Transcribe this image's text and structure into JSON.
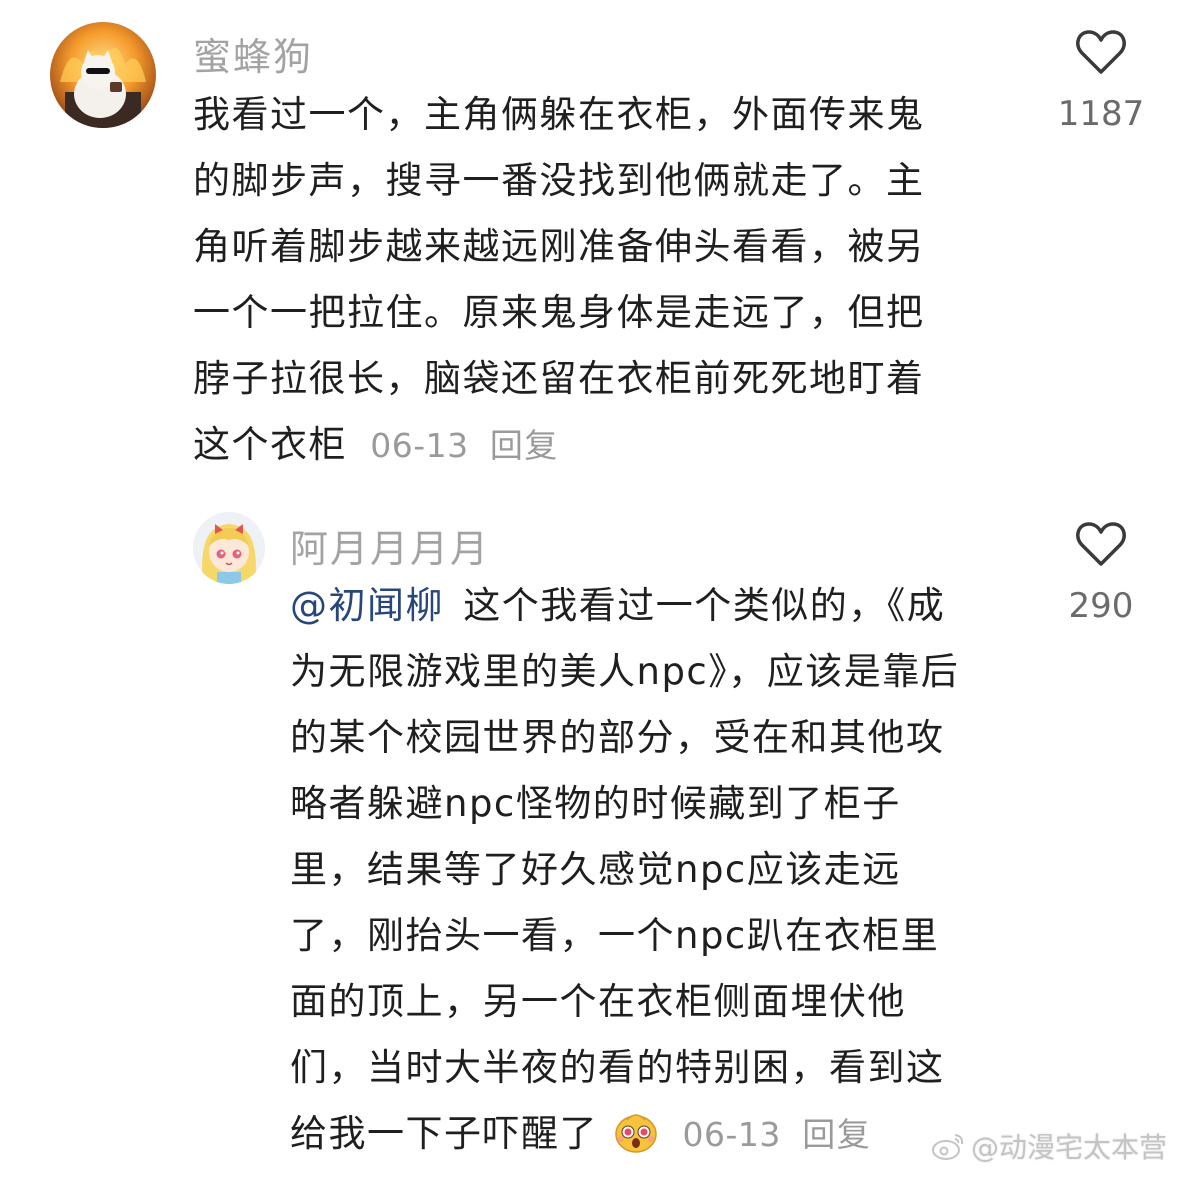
{
  "comments": [
    {
      "username": "蜜蜂狗",
      "avatar_icon": "cat-on-fire-avatar",
      "lines": [
        "我看过一个，主角俩躲在衣柜，外面传来鬼",
        "的脚步声，搜寻一番没找到他俩就走了。主",
        "角听着脚步越来越远刚准备伸头看看，被另",
        "一个一把拉住。原来鬼身体是走远了，但把",
        "脖子拉很长，脑袋还留在衣柜前死死地盯着",
        "这个衣柜"
      ],
      "date": "06-13",
      "reply_label": "回复",
      "likes": "1187"
    },
    {
      "username": "阿月月月月",
      "avatar_icon": "anime-girl-avatar",
      "mention": "@初闻柳",
      "lines": [
        "这个我看过一个类似的，《成",
        "为无限游戏里的美人npc》，应该是靠后",
        "的某个校园世界的部分，受在和其他攻",
        "略者躲避npc怪物的时候藏到了柜子",
        "里，结果等了好久感觉npc应该走远",
        "了，刚抬头一看，一个npc趴在衣柜里",
        "面的顶上，另一个在衣柜侧面埋伏他",
        "们，当时大半夜的看的特别困，看到这",
        "给我一下子吓醒了"
      ],
      "emoji_icon": "shocked-face-emoji",
      "date": "06-13",
      "reply_label": "回复",
      "likes": "290"
    }
  ],
  "watermark": "@动漫宅太本营",
  "colors": {
    "username": "#a3a3a3",
    "body": "#1f1f1f",
    "mention": "#27467a",
    "meta": "#9a9a9a"
  }
}
